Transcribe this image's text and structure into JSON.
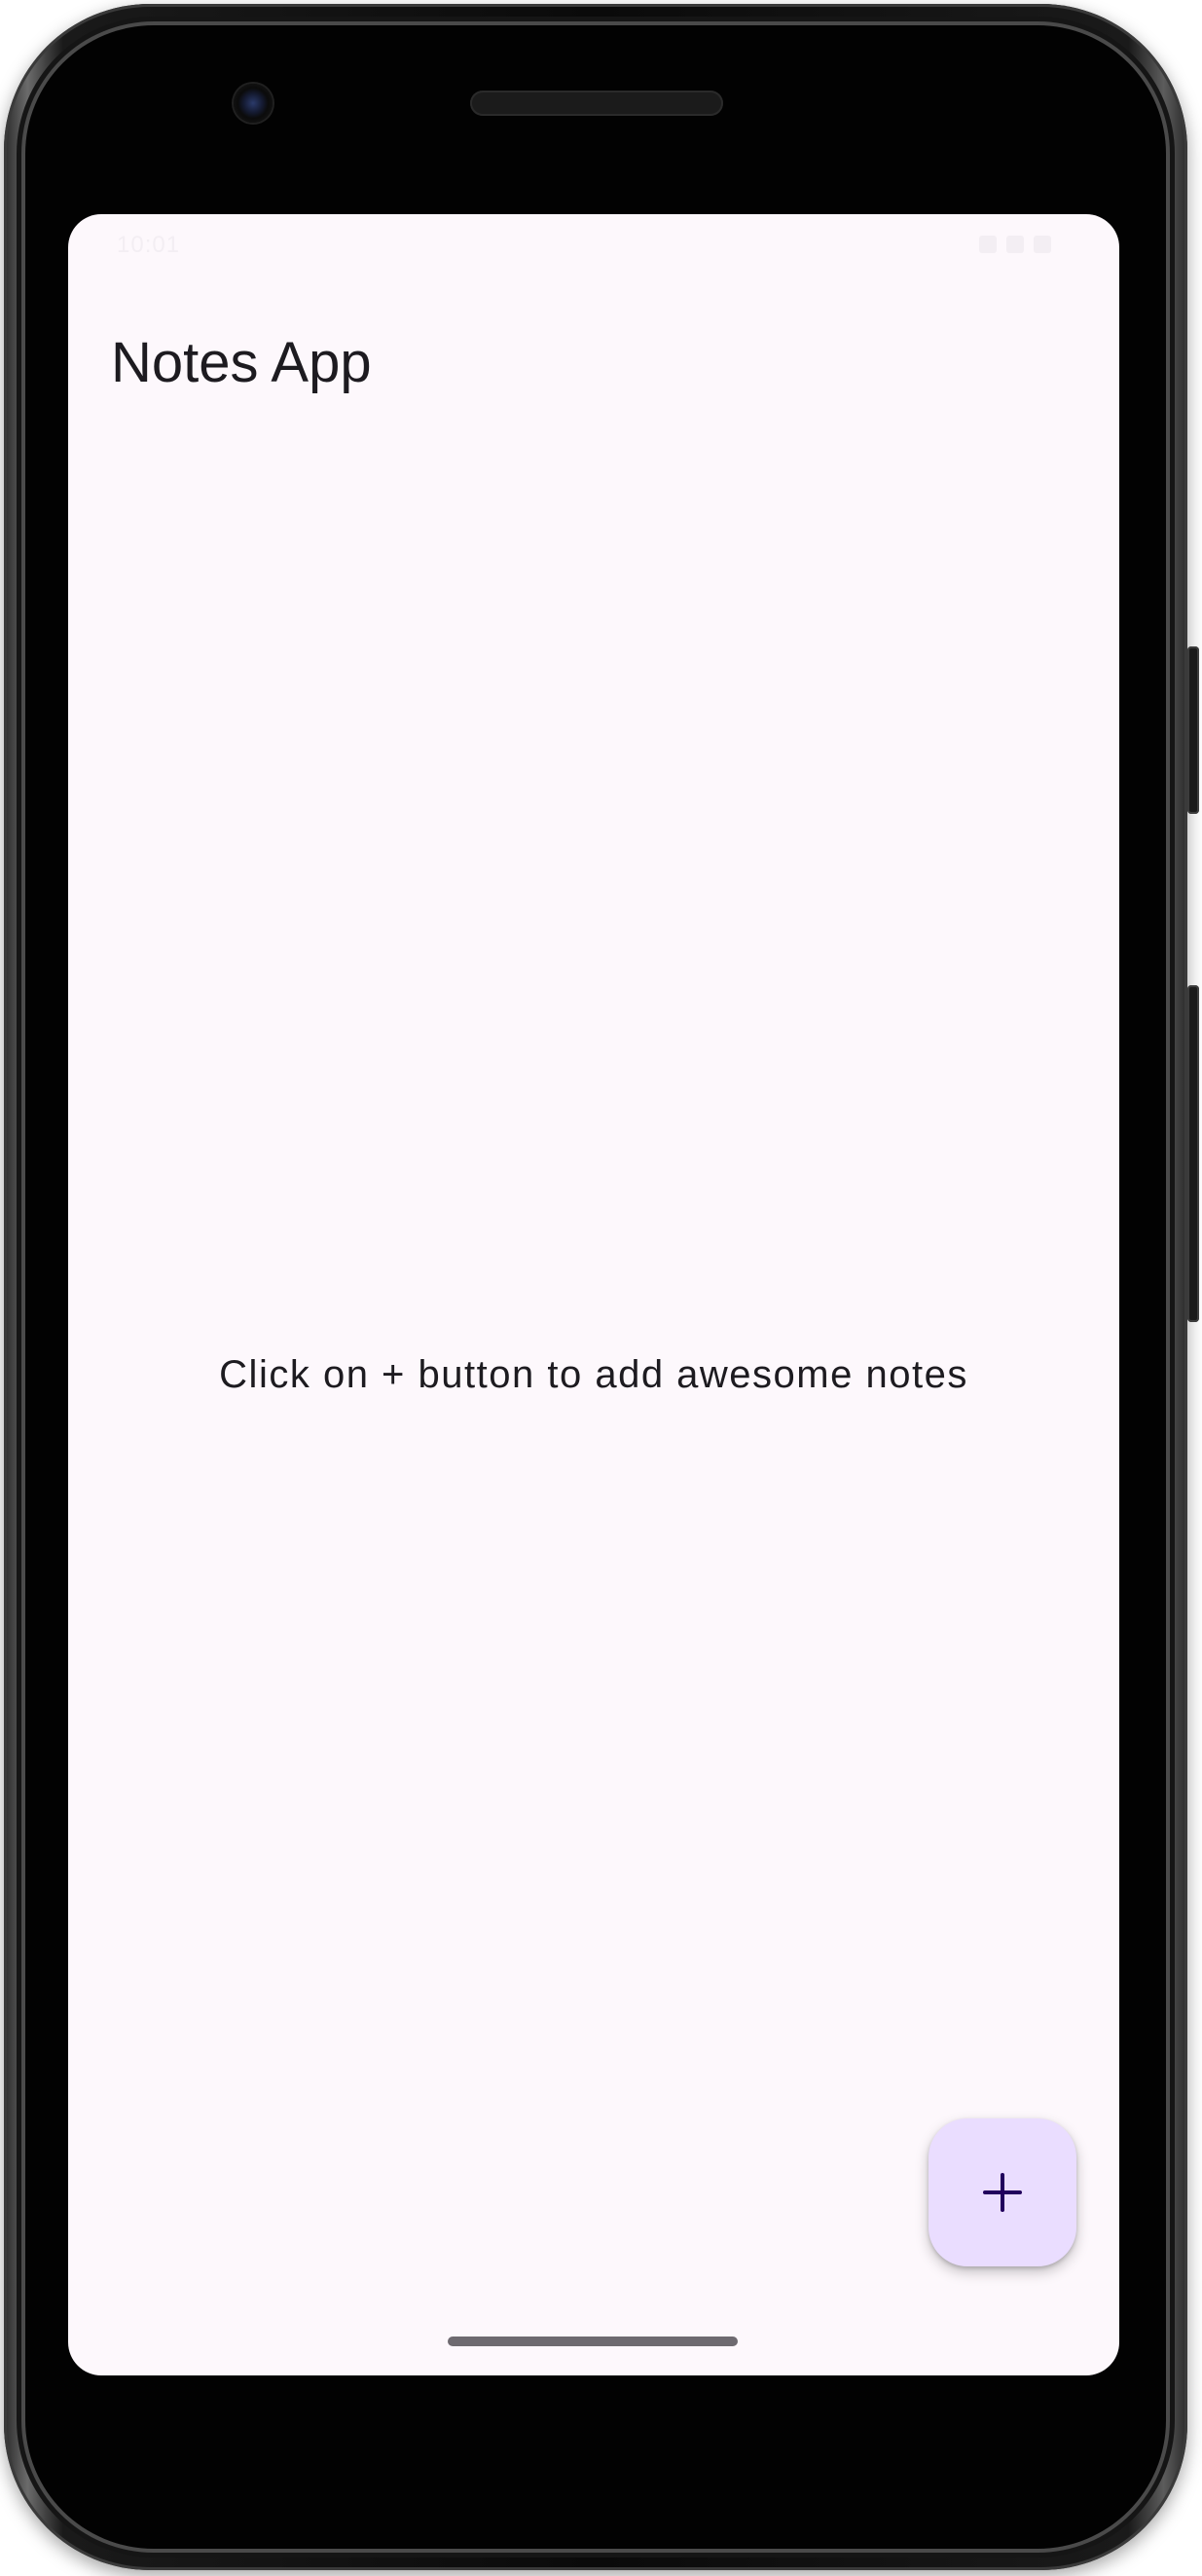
{
  "status_bar": {
    "time": "10:01"
  },
  "app_bar": {
    "title": "Notes App"
  },
  "main": {
    "empty_message": "Click on + button to add awesome notes"
  },
  "fab": {
    "icon": "plus-icon",
    "background_color": "#eaddff",
    "icon_color": "#21005d"
  },
  "theme": {
    "surface_color": "#fdf8fc",
    "text_color": "#1d1b20"
  }
}
